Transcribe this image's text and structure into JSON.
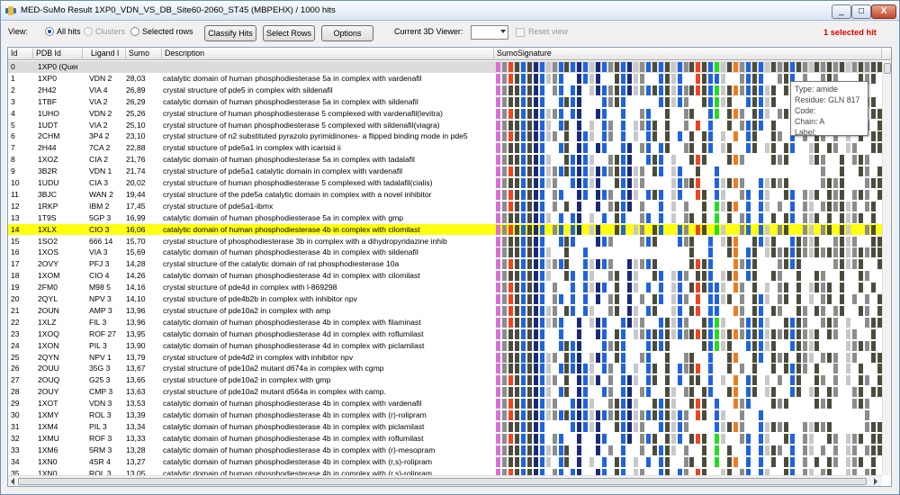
{
  "window": {
    "title": "MED-SuMo Result 1XP0_VDN_VS_DB_Site60-2060_ST45 (MBPEHX) / 1000 hits",
    "controls": [
      "_",
      "□",
      "X"
    ]
  },
  "toolbar": {
    "view_label": "View:",
    "radios": [
      {
        "label": "All hits",
        "checked": true,
        "enabled": true
      },
      {
        "label": "Clusters",
        "checked": false,
        "enabled": false
      },
      {
        "label": "Selected rows",
        "checked": false,
        "enabled": true
      }
    ],
    "buttons": [
      "Classify Hits",
      "Select Rows",
      "Options"
    ],
    "viewer_label": "Current 3D Viewer:",
    "viewer_value": "",
    "reset_label": "Reset view",
    "selected_hits": "1 selected hit"
  },
  "table": {
    "headers": [
      "Id",
      "PDB Id",
      "Ligand I",
      "Sumo",
      "Description",
      "SumoSignature"
    ],
    "rows": [
      [
        "0",
        "1XP0 (Query",
        "",
        "",
        ""
      ],
      [
        "1",
        "1XP0",
        "VDN 2",
        "28,03",
        "catalytic domain of human phosphodiesterase 5a in complex with vardenafil"
      ],
      [
        "2",
        "2H42",
        "VIA 4",
        "26,89",
        "crystal structure of pde5 in complex with sildenafil"
      ],
      [
        "3",
        "1TBF",
        "VIA 2",
        "26,29",
        "catalytic domain of human phosphodiesterase 5a in complex with sildenafil"
      ],
      [
        "4",
        "1UHO",
        "VDN 2",
        "25,26",
        "crystal structure of human phosphodiesterase 5 complexed with vardenafil(levitra)"
      ],
      [
        "5",
        "1UDT",
        "VIA 2",
        "25,10",
        "crystal structure of human phosphodiesterase 5 complexed with sildenafil(viagra)"
      ],
      [
        "6",
        "2CHM",
        "3P4 2",
        "23,10",
        "crystal structure of n2 substituted pyrazolo pyrimidinones- a flipped binding mode in pde5"
      ],
      [
        "7",
        "2H44",
        "7CA 2",
        "22,88",
        "crystal structure of pde5a1 in complex with icarisid ii"
      ],
      [
        "8",
        "1XOZ",
        "CIA 2",
        "21,76",
        "catalytic domain of human phosphodiesterase 5a in complex with tadalafil"
      ],
      [
        "9",
        "3B2R",
        "VDN 1",
        "21,74",
        "crystal structure of pde5a1 catalytic domain in complex with vardenafil"
      ],
      [
        "10",
        "1UDU",
        "CIA 3",
        "20,02",
        "crystal structure of human phosphodiesterase 5 complexed with tadalafil(cialis)"
      ],
      [
        "11",
        "3BJC",
        "WAN 2",
        "19,44",
        "crystal structure of the pde5a catalytic domain in complex with a novel inhibitor"
      ],
      [
        "12",
        "1RKP",
        "IBM 2",
        "17,45",
        "crystal structure of pde5a1-ibmx"
      ],
      [
        "13",
        "1T9S",
        "5GP 3",
        "16,99",
        "catalytic domain of human phosphodiesterase 5a in complex with gmp"
      ],
      [
        "14",
        "1XLX",
        "CIO 3",
        "16,06",
        "catalytic domain of human phosphodiesterase 4b in complex with cilomilast"
      ],
      [
        "15",
        "1SO2",
        "666 14",
        "15,70",
        "crystal structure of phosphodiesterase 3b in complex with a dihydropyridazine inhib"
      ],
      [
        "16",
        "1XOS",
        "VIA 3",
        "15,69",
        "catalytic domain of human phosphodiesterase 4b in complex with sildenafil"
      ],
      [
        "17",
        "2OVY",
        "PFJ 3",
        "14,28",
        "crystal structure of the catalytic domain of rat phosphodiesterase 10a"
      ],
      [
        "18",
        "1XOM",
        "CIO 4",
        "14,26",
        "catalytic domain of human phosphodiesterase 4d in complex with cilomilast"
      ],
      [
        "19",
        "2FM0",
        "M98 5",
        "14,16",
        "crystal structure of pde4d in complex with l-869298"
      ],
      [
        "20",
        "2QYL",
        "NPV 3",
        "14,10",
        "crystal structure of pde4b2b in complex with inhibitor npv"
      ],
      [
        "21",
        "2OUN",
        "AMP 3",
        "13,96",
        "crystal structure of pde10a2 in complex with amp"
      ],
      [
        "22",
        "1XLZ",
        "FIL 3",
        "13,96",
        "catalytic domain of human phosphodiesterase 4b in complex with filaminast"
      ],
      [
        "23",
        "1XOQ",
        "ROF 27",
        "13,95",
        "catalytic domain of human phosphodiesterase 4d in complex with roflumilast"
      ],
      [
        "24",
        "1XON",
        "PIL 3",
        "13,90",
        "catalytic domain of human phosphodiesterase 4d in complex with piclamilast"
      ],
      [
        "25",
        "2QYN",
        "NPV 1",
        "13,79",
        "crystal structure of pde4d2 in complex with inhibitor npv"
      ],
      [
        "26",
        "2OUU",
        "35G 3",
        "13,67",
        "crystal structure of pde10a2 mutant d674a in complex with cgmp"
      ],
      [
        "27",
        "2OUQ",
        "G25 3",
        "13,65",
        "crystal structure of pde10a2 in complex with gmp"
      ],
      [
        "28",
        "2OUY",
        "CMP 3",
        "13,63",
        "crystal structure of pde10a2 mutant d564a in complex with camp."
      ],
      [
        "29",
        "1XOT",
        "VDN 3",
        "13,53",
        "catalytic domain of human phosphodiesterase 4b in complex with vardenafil"
      ],
      [
        "30",
        "1XMY",
        "ROL 3",
        "13,39",
        "catalytic domain of human phosphodiesterase 4b in complex with (r)-rolipram"
      ],
      [
        "31",
        "1XM4",
        "PIL 3",
        "13,34",
        "catalytic domain of human phosphodiesterase 4b in complex with piclamilast"
      ],
      [
        "32",
        "1XMU",
        "ROF 3",
        "13,33",
        "catalytic domain of human phosphodiesterase 4b in complex with roflumilast"
      ],
      [
        "33",
        "1XM6",
        "5RM 3",
        "13,28",
        "catalytic domain of human phosphodiesterase 4b in complex with (r)-mesopram"
      ],
      [
        "34",
        "1XN0",
        "4SR 4",
        "13,27",
        "catalytic domain of human phosphodiesterase 4b in complex with (r,s)-rolipram"
      ],
      [
        "35",
        "1XN0",
        "ROL 3",
        "13,05",
        "catalytic domain of human phosphodiesterase 4b in complex with (r,s)-rolipram"
      ]
    ],
    "selected_row_index": 14
  },
  "signature_colors": {
    "magenta": "#d970d9",
    "gray": "#8c8c8c",
    "dark": "#4c4c3c",
    "blue": "#1e64e0",
    "navy": "#1a2a7a",
    "red": "#ee4422",
    "orange": "#f07a20",
    "green": "#22dd22",
    "olive": "#c0b000",
    "lightgray": "#c8c8c8"
  },
  "tooltip": {
    "type": "Type: amide",
    "residue": "Residue: GLN 817",
    "code": "Code:",
    "chain": "Chain: A",
    "label": "Label:"
  }
}
